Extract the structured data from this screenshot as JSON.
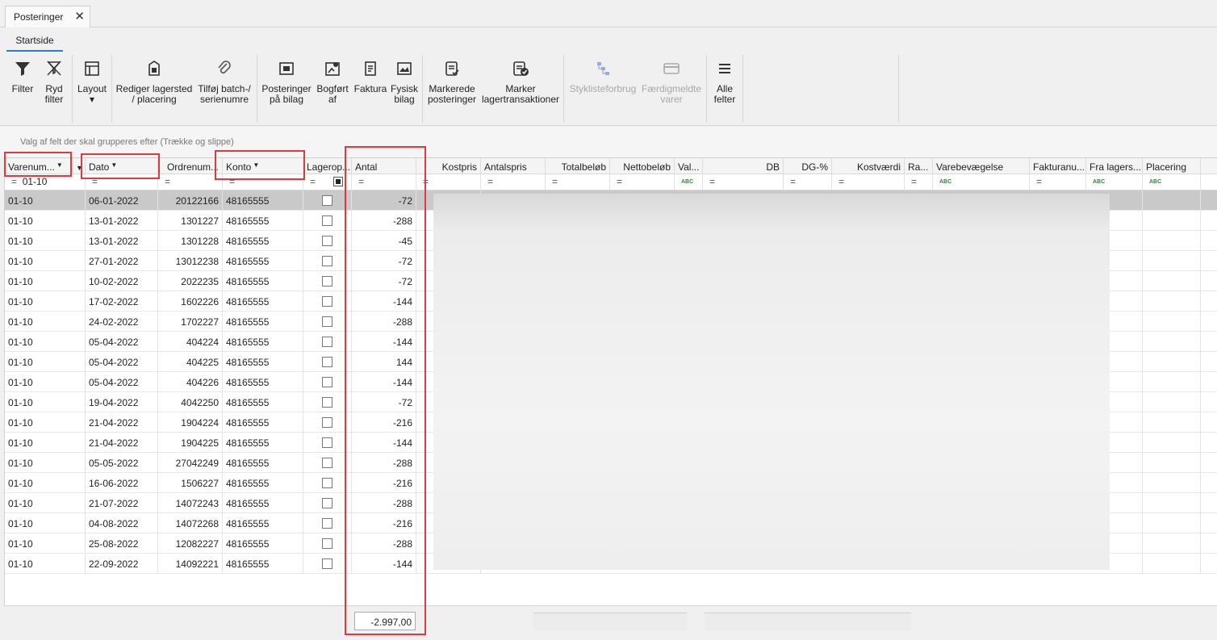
{
  "doc_tab": {
    "label": "Posteringer",
    "close": "✕"
  },
  "ribbon_tab": "Startside",
  "ribbon": {
    "filter": "Filter",
    "clear_filter_1": "Ryd",
    "clear_filter_2": "filter",
    "layout": "Layout",
    "layout_arrow": "▾",
    "edit_location_1": "Rediger lagersted",
    "edit_location_2": "/ placering",
    "add_batch_1": "Tilføj batch-/",
    "add_batch_2": "serienumre",
    "entries_doc_1": "Posteringer",
    "entries_doc_2": "på bilag",
    "posted_by_1": "Bogført",
    "posted_by_2": "af",
    "invoice": "Faktura",
    "physical_doc_1": "Fysisk",
    "physical_doc_2": "bilag",
    "marked_entries_1": "Markerede",
    "marked_entries_2": "posteringer",
    "mark_transactions_1": "Marker",
    "mark_transactions_2": "lagertransaktioner",
    "bom_usage": "Styklisteforbrug",
    "finished_1": "Færdigmeldte",
    "finished_2": "varer",
    "all_fields_1": "Alle",
    "all_fields_2": "felter"
  },
  "group_panel_hint": "Valg af felt der skal grupperes efter (Trække og slippe)",
  "columns": {
    "varenummer": "Varenum...",
    "dato": "Dato",
    "ordrenummer": "Ordrenum...",
    "konto": "Konto",
    "lagerop": "Lagerop...",
    "antal": "Antal",
    "kostpris": "Kostpris",
    "antalspris": "Antalspris",
    "totalbelob": "Totalbeløb",
    "nettobelob": "Nettobeløb",
    "valuta": "Val...",
    "db": "DB",
    "dg": "DG-%",
    "kostvaerdi": "Kostværdi",
    "rabat": "Ra...",
    "varebevaegelse": "Varebevægelse",
    "fakturanummer": "Fakturanu...",
    "fra_lager": "Fra lagers...",
    "placering": "Placering"
  },
  "filter": {
    "varenummer_value": "01-10",
    "eq": "=",
    "abc": "ABC"
  },
  "rows": [
    {
      "varenr": "01-10",
      "dato": "06-01-2022",
      "ordre": "20122166",
      "konto": "48165555",
      "antal": "-72"
    },
    {
      "varenr": "01-10",
      "dato": "13-01-2022",
      "ordre": "1301227",
      "konto": "48165555",
      "antal": "-288"
    },
    {
      "varenr": "01-10",
      "dato": "13-01-2022",
      "ordre": "1301228",
      "konto": "48165555",
      "antal": "-45"
    },
    {
      "varenr": "01-10",
      "dato": "27-01-2022",
      "ordre": "13012238",
      "konto": "48165555",
      "antal": "-72"
    },
    {
      "varenr": "01-10",
      "dato": "10-02-2022",
      "ordre": "2022235",
      "konto": "48165555",
      "antal": "-72"
    },
    {
      "varenr": "01-10",
      "dato": "17-02-2022",
      "ordre": "1602226",
      "konto": "48165555",
      "antal": "-144"
    },
    {
      "varenr": "01-10",
      "dato": "24-02-2022",
      "ordre": "1702227",
      "konto": "48165555",
      "antal": "-288"
    },
    {
      "varenr": "01-10",
      "dato": "05-04-2022",
      "ordre": "404224",
      "konto": "48165555",
      "antal": "-144"
    },
    {
      "varenr": "01-10",
      "dato": "05-04-2022",
      "ordre": "404225",
      "konto": "48165555",
      "antal": "144"
    },
    {
      "varenr": "01-10",
      "dato": "05-04-2022",
      "ordre": "404226",
      "konto": "48165555",
      "antal": "-144"
    },
    {
      "varenr": "01-10",
      "dato": "19-04-2022",
      "ordre": "4042250",
      "konto": "48165555",
      "antal": "-72"
    },
    {
      "varenr": "01-10",
      "dato": "21-04-2022",
      "ordre": "1904224",
      "konto": "48165555",
      "antal": "-216"
    },
    {
      "varenr": "01-10",
      "dato": "21-04-2022",
      "ordre": "1904225",
      "konto": "48165555",
      "antal": "-144"
    },
    {
      "varenr": "01-10",
      "dato": "05-05-2022",
      "ordre": "27042249",
      "konto": "48165555",
      "antal": "-288"
    },
    {
      "varenr": "01-10",
      "dato": "16-06-2022",
      "ordre": "1506227",
      "konto": "48165555",
      "antal": "-216"
    },
    {
      "varenr": "01-10",
      "dato": "21-07-2022",
      "ordre": "14072243",
      "konto": "48165555",
      "antal": "-288"
    },
    {
      "varenr": "01-10",
      "dato": "04-08-2022",
      "ordre": "14072268",
      "konto": "48165555",
      "antal": "-216"
    },
    {
      "varenr": "01-10",
      "dato": "25-08-2022",
      "ordre": "12082227",
      "konto": "48165555",
      "antal": "-288"
    },
    {
      "varenr": "01-10",
      "dato": "22-09-2022",
      "ordre": "14092221",
      "konto": "48165555",
      "antal": "-144"
    }
  ],
  "total_antal": "-2.997,00",
  "colors": {
    "highlight": "#e0393e",
    "selected_row": "#c9c9c9",
    "tab_accent": "#2b7cd3"
  }
}
